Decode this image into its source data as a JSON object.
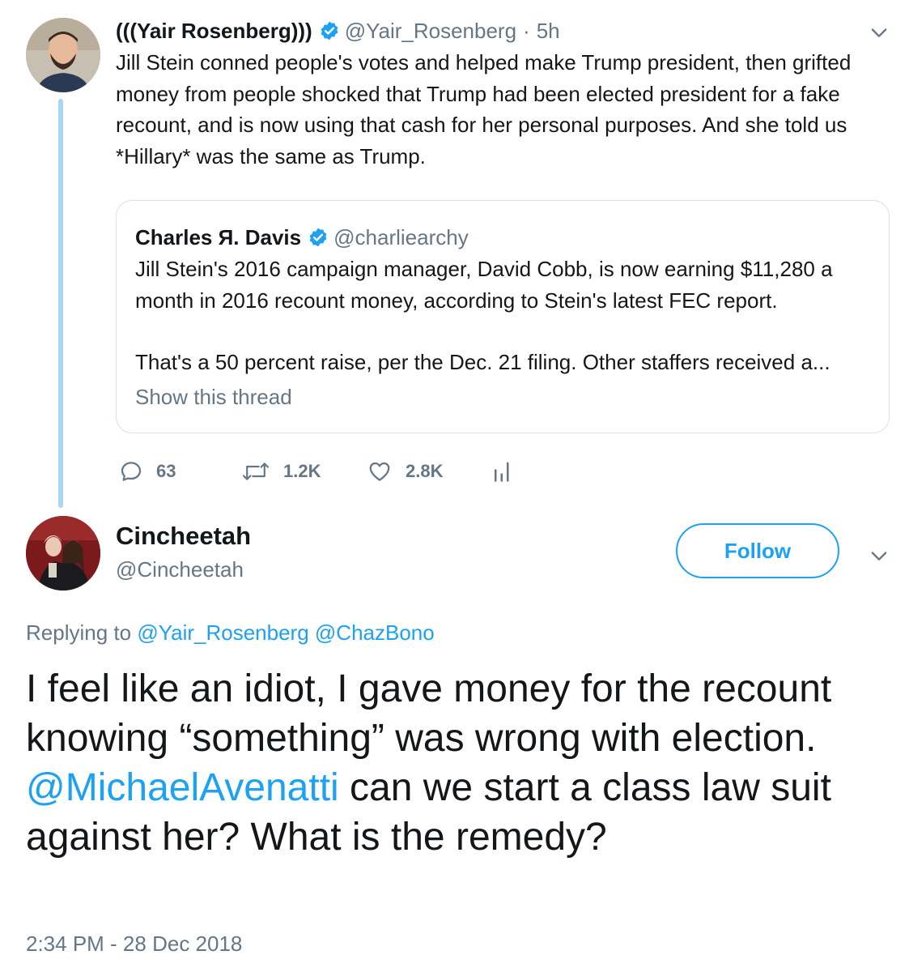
{
  "tweet": {
    "author_name": "(((Yair Rosenberg)))",
    "author_handle": "@Yair_Rosenberg",
    "separator": "·",
    "time": "5h",
    "text": "Jill Stein conned people's votes and helped make Trump president, then grifted money from people shocked that Trump had been elected president for a fake recount, and is now using that cash for her personal purposes. And she told us *Hillary* was the same as Trump.",
    "quoted": {
      "author_name": "Charles Я. Davis",
      "author_handle": "@charliearchy",
      "text_p1": "Jill Stein's 2016 campaign manager, David Cobb, is now earning $11,280 a month in 2016 recount money, according to Stein's latest FEC report.",
      "text_p2": "That's a 50 percent raise, per the Dec. 21 filing. Other staffers received a...",
      "show_thread": "Show this thread"
    },
    "actions": {
      "replies": "63",
      "retweets": "1.2K",
      "likes": "2.8K"
    }
  },
  "reply": {
    "author_name": "Cincheetah",
    "author_handle": "@Cincheetah",
    "follow_label": "Follow",
    "replying_prefix": "Replying to",
    "replying_to_1": "@Yair_Rosenberg",
    "replying_to_2": "@ChazBono",
    "text_before_mention": "I feel like an idiot, I gave money for the recount knowing “something” was wrong with election. ",
    "mention": "@MichaelAvenatti",
    "text_after_mention": " can we start a class law suit against her? What is the remedy?",
    "timestamp": "2:34 PM - 28 Dec 2018"
  },
  "icons": {
    "verified": "verified-badge-icon",
    "caret": "chevron-down-icon",
    "reply": "reply-icon",
    "retweet": "retweet-icon",
    "like": "heart-icon",
    "analytics": "analytics-icon"
  },
  "colors": {
    "accent": "#1da1f2",
    "muted": "#657786",
    "thread_line": "#a9d6f5",
    "text": "#14171a"
  }
}
